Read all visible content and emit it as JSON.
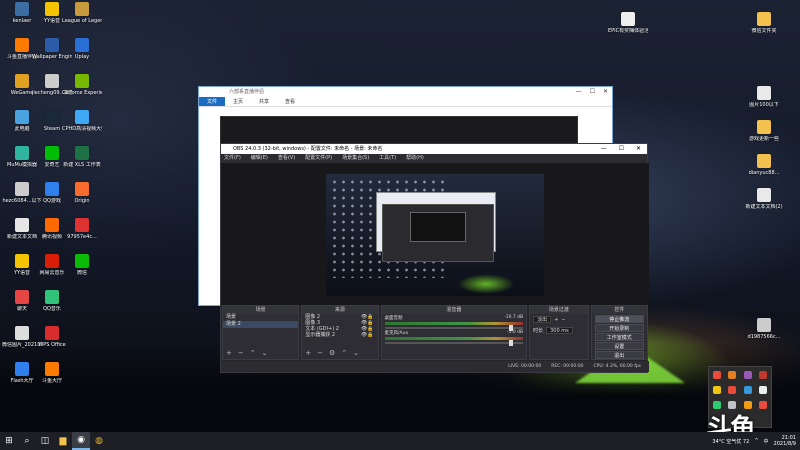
{
  "desktop": {
    "icons": [
      {
        "label": "kenlaer",
        "color": "#3a6ea5"
      },
      {
        "label": "斗鱼直播伴侣",
        "color": "#ff7a00"
      },
      {
        "label": "WeGame",
        "color": "#e0a020"
      },
      {
        "label": "此电脑",
        "color": "#4aa3df"
      },
      {
        "label": "MuMu模拟器",
        "color": "#2fb4a0"
      },
      {
        "label": "hezc6084...以下",
        "color": "#cccccc"
      },
      {
        "label": "新建文本文档",
        "color": "#e6e6e6"
      },
      {
        "label": "YY语音",
        "color": "#f5c400"
      },
      {
        "label": "聊天",
        "color": "#e64545"
      },
      {
        "label": "微信图片_2021010...",
        "color": "#ddd"
      },
      {
        "label": "Flash大厅",
        "color": "#2f80ed"
      },
      {
        "label": "YY语音",
        "color": "#f5c400"
      },
      {
        "label": "Wallpaper Engine",
        "color": "#2a5ca8"
      },
      {
        "label": "jiecheng09...数据",
        "color": "#ccc"
      },
      {
        "label": "Steam",
        "color": "#1b2838"
      },
      {
        "label": "爱奇艺",
        "color": "#00be06"
      },
      {
        "label": "QQ游戏",
        "color": "#2f80ed"
      },
      {
        "label": "腾讯视频",
        "color": "#ff6a00"
      },
      {
        "label": "网易云音乐",
        "color": "#d81e06"
      },
      {
        "label": "QQ音乐",
        "color": "#31c27c"
      },
      {
        "label": "WPS Office",
        "color": "#d72d2d"
      },
      {
        "label": "斗鱼大厅",
        "color": "#ff7a00"
      },
      {
        "label": "League of Legends",
        "color": "#c79b3b"
      },
      {
        "label": "Uplay",
        "color": "#2a6fd6"
      },
      {
        "label": "GeForce Experience",
        "color": "#76b900"
      },
      {
        "label": "CPHD高清视频大师",
        "color": "#3fa9f5"
      },
      {
        "label": "新建 XLS 工作表",
        "color": "#1e7145"
      },
      {
        "label": "Origin",
        "color": "#f56c2d"
      },
      {
        "label": "97957e4c...",
        "color": "#d33"
      },
      {
        "label": "微信",
        "color": "#09bb07"
      }
    ],
    "right_icons": [
      {
        "label": "EPIC有奖嗨体验活动介绍",
        "color": "#eeeeee"
      },
      {
        "label": "微信文件夹",
        "color": "#f2c14e"
      },
      {
        "label": "图片100以下",
        "color": "#e9e9e9"
      },
      {
        "label": "游戏更新一些",
        "color": "#f2c14e"
      },
      {
        "label": "dianyuc88...",
        "color": "#f2c14e"
      },
      {
        "label": "新建文本文档(2)",
        "color": "#e9e9e9"
      },
      {
        "label": "d1987566c...",
        "color": "#ccc"
      }
    ]
  },
  "explorer": {
    "title": "六部系直播伴侣",
    "tabs": [
      "文件",
      "主页",
      "共享",
      "查看"
    ]
  },
  "obs": {
    "title": "OBS 24.0.3 (32-bit, windows) - 配置文件: 未命名 - 场景: 未命名",
    "menu": [
      "文件(F)",
      "编辑(E)",
      "查看(V)",
      "配置文件(P)",
      "场景集合(S)",
      "工具(T)",
      "帮助(H)"
    ],
    "docks": {
      "scenes": {
        "header": "场景",
        "items": [
          "场景",
          "场景 2"
        ]
      },
      "sources": {
        "header": "来源",
        "items": [
          "图像 2",
          "图像 3",
          "文本 (GDI+) 2",
          "显示器捕获 2"
        ]
      },
      "mixer": {
        "header": "混音器",
        "tracks": [
          {
            "name": "桌面音频",
            "db": "-10.7 dB"
          },
          {
            "name": "麦克风/Aux",
            "db": "-5.0 dB"
          }
        ]
      },
      "transitions": {
        "header": "场景过渡",
        "type": "淡出",
        "duration_label": "时长",
        "duration": "300 ms"
      },
      "controls": {
        "header": "控件",
        "buttons": [
          "停止推流",
          "开始录制",
          "工作室模式",
          "设置",
          "退出"
        ]
      }
    },
    "status": [
      "LIVE: 00:00:00",
      "REC: 00:00:00",
      "CPU: 4.3%, 60.00 fps"
    ]
  },
  "taskbar": {
    "start_icon": "windows-logo-icon",
    "apps": [
      "search-icon",
      "task-view-icon",
      "file-explorer-icon",
      "obs-icon",
      "chrome-icon"
    ],
    "weather": "34°C 空气优 72",
    "ime": "中",
    "time": "21:01",
    "date": "2021/8/9"
  },
  "watermark": "斗鱼"
}
